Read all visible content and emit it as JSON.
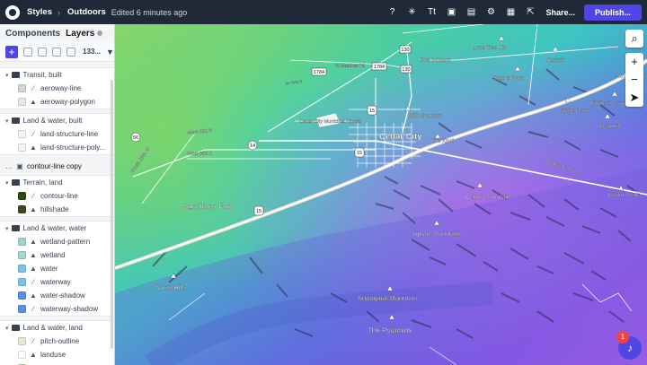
{
  "topbar": {
    "section": "Styles",
    "style_name": "Outdoors",
    "edited": "Edited 6 minutes ago",
    "share_label": "Share...",
    "publish_label": "Publish..."
  },
  "sidebar": {
    "tab_components": "Components",
    "tab_layers": "Layers",
    "layer_count": "133...",
    "groups": [
      {
        "title": "Transit, built",
        "layers": [
          {
            "label": "aeroway-line",
            "kind": "line",
            "color": "#d1d5db"
          },
          {
            "label": "aeroway-polygon",
            "kind": "fill",
            "color": "#e5e7eb"
          }
        ]
      },
      {
        "title": "Land & water, built",
        "layers": [
          {
            "label": "land-structure-line",
            "kind": "line",
            "color": "#f3f4f6"
          },
          {
            "label": "land-structure-poly...",
            "kind": "fill",
            "color": "#f3f4f6"
          }
        ]
      },
      {
        "title": "Terrain, land",
        "layers": [
          {
            "label": "contour-line",
            "kind": "line",
            "color": "#2d4a12"
          },
          {
            "label": "hillshade",
            "kind": "fill",
            "color": "#3f4a1f"
          }
        ]
      },
      {
        "title": "Land & water, water",
        "layers": [
          {
            "label": "wetland-pattern",
            "kind": "fill",
            "color": "#9fd3c7"
          },
          {
            "label": "wetland",
            "kind": "fill",
            "color": "#a5d8d0"
          },
          {
            "label": "water",
            "kind": "fill",
            "color": "#7cc4e8"
          },
          {
            "label": "waterway",
            "kind": "line",
            "color": "#7cc4e8"
          },
          {
            "label": "water-shadow",
            "kind": "fill",
            "color": "#5b8fe0"
          },
          {
            "label": "waterway-shadow",
            "kind": "line",
            "color": "#5b8fe0"
          }
        ]
      },
      {
        "title": "Land & water, land",
        "layers": [
          {
            "label": "pitch-outline",
            "kind": "line",
            "color": "#e3ecd0"
          },
          {
            "label": "landuse",
            "kind": "fill",
            "color": "#ffffff"
          },
          {
            "label": "national-park_tint-...",
            "kind": "fill",
            "color": "#bde0a5"
          }
        ]
      }
    ],
    "single_layer": "contour-line copy"
  },
  "map": {
    "labels": {
      "cedar_city": "Cedar City",
      "hamiltons_fort": "Hamiltons Fort",
      "fort_johnson": "Fort Johnson",
      "cedar_city_airport": "Cedar City Municipal Airport",
      "wild_mountain": "Wild Mountain",
      "the_knoll": "The Knoll",
      "cedar_mountain": "Cedar Mountain",
      "cedar_peak": "Cedar Peak",
      "square_mountain": "Square Mountain",
      "north_hills": "North Hills",
      "supaginal_mountain": "Supaginal Mountain",
      "the_pyramids": "The Pyramids",
      "cedar_canyon": "Cedar Canyon",
      "square_rock": "Square Rock",
      "summit": "Summit",
      "lone_tree_hill": "Lone Tree Hill",
      "fiddlers_canyon": "Fiddlers Canyon",
      "kolob_peak": "Kolob Peak",
      "apple_peak": "Apple Peak",
      "red_hill": "Red Hill",
      "west_200_n": "West 200 N",
      "w_ww": "W Ww 8",
      "west_800_s": "West 800 S",
      "south_15th_w": "South 15th W",
      "w_meadow_rd": "W Meadow Rd",
      "i15_1": "15",
      "i15_2": "15",
      "i15_3": "15",
      "r56": "56",
      "r130": "130",
      "r14": "14",
      "r1784": "1784",
      "r1784b": "1784",
      "r130b": "130"
    },
    "notification_count": "1"
  }
}
